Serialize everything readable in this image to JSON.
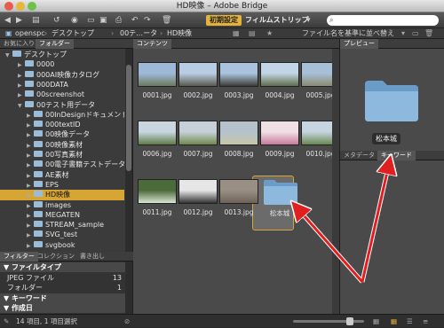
{
  "window": {
    "title": "HD映像 – Adobe Bridge"
  },
  "toolbar": {
    "workspace_active": "初期設定",
    "workspace_label": "フィルムストリップ",
    "search_placeholder": ""
  },
  "path": {
    "items": [
      "openspc",
      "デスクトップ",
      "00テ…ータ",
      "HD映像"
    ],
    "sort_label": "ファイル名を基準に並べ替え"
  },
  "left_panel": {
    "tabs": [
      "お気に入り",
      "フォルダー"
    ],
    "tree": [
      "デスクトップ",
      "0000",
      "000AI映像カタログ",
      "000DATA",
      "00screenshot",
      "00テスト用データ",
      "00InDesignドキュメント",
      "000textID",
      "00映像データ",
      "00映像素材",
      "00写真素材",
      "00電子書籍テストデータ",
      "AE素材",
      "EPS",
      "HD映像",
      "images",
      "MEGATEN",
      "STREAM_sample",
      "SVG_test",
      "svgbook"
    ]
  },
  "filter_panel": {
    "tabs": [
      "フィルター",
      "コレクション",
      "書き出し"
    ],
    "rows": [
      {
        "label": "ファイルタイプ",
        "count": "",
        "head": true
      },
      {
        "label": "JPEG ファイル",
        "count": "13",
        "head": false
      },
      {
        "label": "フォルダー",
        "count": "1",
        "head": false
      },
      {
        "label": "キーワード",
        "count": "",
        "head": true
      },
      {
        "label": "作成日",
        "count": "",
        "head": true
      }
    ]
  },
  "content": {
    "tab": "コンテンツ",
    "items": [
      "0001.jpg",
      "0002.jpg",
      "0003.jpg",
      "0004.jpg",
      "0005.jpg",
      "0006.jpg",
      "0007.jpg",
      "0008.jpg",
      "0009.jpg",
      "0010.jpg",
      "0011.jpg",
      "0012.jpg",
      "0013.jpg",
      "松本城"
    ]
  },
  "preview": {
    "tab": "プレビュー",
    "caption": "松本城",
    "meta_tabs": [
      "メタデータ",
      "キーワード"
    ]
  },
  "status": {
    "text": "14 項目, 1 項目選択"
  },
  "colors": {
    "accent": "#d7a533",
    "arrow": "#e02020"
  }
}
